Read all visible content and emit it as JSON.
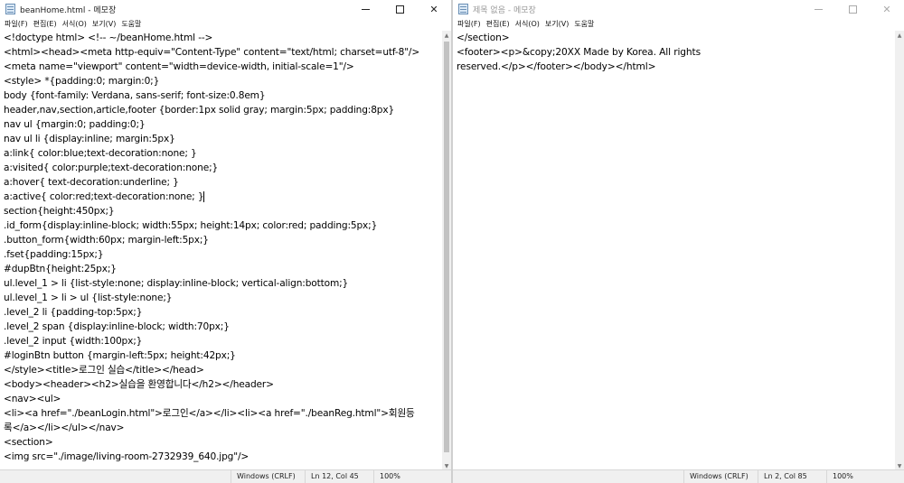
{
  "left": {
    "title": "beanHome.html - 메모장",
    "menu": [
      "파일(F)",
      "편집(E)",
      "서식(O)",
      "보기(V)",
      "도움말"
    ],
    "lines": [
      "<!doctype html> <!-- ~/beanHome.html -->",
      "<html><head><meta http-equiv=\"Content-Type\" content=\"text/html; charset=utf-8\"/>",
      "<meta name=\"viewport\" content=\"width=device-width, initial-scale=1\"/>",
      "<style> *{padding:0; margin:0;}",
      " body {font-family: Verdana, sans-serif; font-size:0.8em}",
      " header,nav,section,article,footer {border:1px solid gray; margin:5px; padding:8px}",
      " nav ul {margin:0; padding:0;}",
      " nav ul li {display:inline; margin:5px}",
      " a:link{ color:blue;text-decoration:none; }",
      " a:visited{ color:purple;text-decoration:none;}",
      " a:hover{ text-decoration:underline; }",
      " a:active{ color:red;text-decoration:none; }",
      " section{height:450px;}",
      " .id_form{display:inline-block; width:55px; height:14px; color:red; padding:5px;}",
      " .button_form{width:60px; margin-left:5px;}",
      " .fset{padding:15px;}",
      " #dupBtn{height:25px;}",
      " ul.level_1 > li {list-style:none; display:inline-block; vertical-align:bottom;}",
      " ul.level_1 > li > ul {list-style:none;}",
      " .level_2 li {padding-top:5px;}",
      " .level_2 span {display:inline-block; width:70px;}",
      " .level_2 input {width:100px;}",
      " #loginBtn button {margin-left:5px; height:42px;}",
      " </style><title>로그인 실습</title></head>",
      " <body><header><h2>실습을 환영합니다</h2></header>",
      " <nav><ul>",
      " <li><a href=\"./beanLogin.html\">로그인</a></li><li><a href=\"./beanReg.html\">회원등",
      "록</a></li></ul></nav>",
      "<section>",
      " <img src=\"./image/living-room-2732939_640.jpg\"/>"
    ],
    "status": {
      "encoding": "Windows (CRLF)",
      "position": "Ln 12, Col 45",
      "zoom": "100%"
    }
  },
  "right": {
    "title": "제목 없음 - 메모장",
    "menu": [
      "파일(F)",
      "편집(E)",
      "서식(O)",
      "보기(V)",
      "도움말"
    ],
    "lines": [
      "</section>",
      "<footer><p>&copy;20XX Made by Korea. All rights",
      "reserved.</p></footer></body></html>"
    ],
    "status": {
      "encoding": "Windows (CRLF)",
      "position": "Ln 2, Col 85",
      "zoom": "100%"
    }
  }
}
